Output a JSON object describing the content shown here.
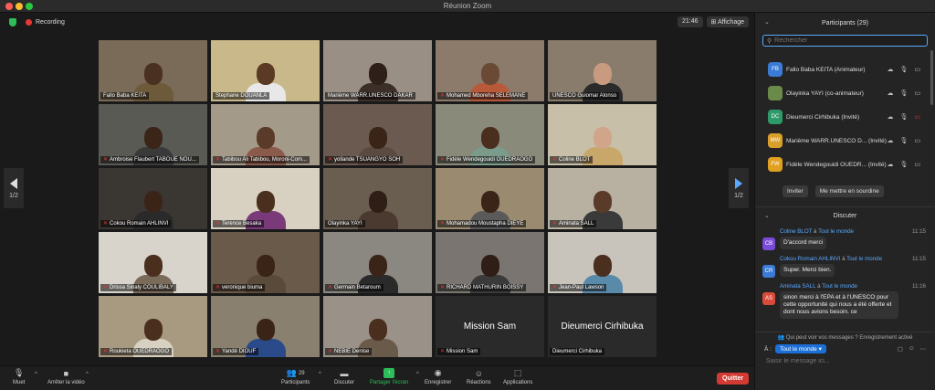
{
  "window": {
    "title": "Réunion Zoom"
  },
  "meeting": {
    "recording_label": "Recording",
    "time": "21:46",
    "view_label": "Affichage",
    "page_left": "1/2",
    "page_right": "1/2"
  },
  "tiles": [
    {
      "name": "Fallo Baba KEITA",
      "muted": false,
      "bg": "#7a6a58",
      "skin": "#4a3020",
      "shirt": "#6d5a3a"
    },
    {
      "name": "Stephane DOUANLA",
      "muted": false,
      "bg": "#c9b98a",
      "skin": "#5a3a25",
      "shirt": "#e8e8e8"
    },
    {
      "name": "Marième WARR.UNESCO DAKAR",
      "muted": false,
      "bg": "#9a8f85",
      "skin": "#2e1f18",
      "shirt": "#3c2e28"
    },
    {
      "name": "Mohamed  Mboreha SELEMANE",
      "muted": true,
      "bg": "#8c7a6a",
      "skin": "#6a4a34",
      "shirt": "#b85a3a"
    },
    {
      "name": "UNESCO Guiomar Alonso",
      "muted": false,
      "bg": "#8a7c6c",
      "skin": "#c89a80",
      "shirt": "#2a2a2a"
    },
    {
      "name": "Ambroise Flaubert TABOUE NOU...",
      "muted": true,
      "bg": "#5a5a55",
      "skin": "#3a2518",
      "shirt": "#3a3a3a"
    },
    {
      "name": "Tabibou Ali Tabibou, Moroni-Com...",
      "muted": true,
      "bg": "#a49a8a",
      "skin": "#5a3a28",
      "shirt": "#8a5a4a"
    },
    {
      "name": "yollande TSUANGYO SOH",
      "muted": true,
      "bg": "#6a5a50",
      "skin": "#3a2418",
      "shirt": "#5a4a40"
    },
    {
      "name": "Fidèle Wendegouidi OUEDRAOGO",
      "muted": true,
      "bg": "#8a8a7a",
      "skin": "#4a2e1e",
      "shirt": "#7a9a8a"
    },
    {
      "name": "Coline BLOT",
      "muted": true,
      "bg": "#c8bfa8",
      "skin": "#d0a58a",
      "shirt": "#c8a86a"
    },
    {
      "name": "Cokou Romain AHLINVI",
      "muted": true,
      "bg": "#3a3632",
      "skin": "#3a2418",
      "shirt": "#2a2a2a"
    },
    {
      "name": "Terence Besaka",
      "muted": true,
      "bg": "#d8d0c0",
      "skin": "#4a2e1e",
      "shirt": "#7a3a7a"
    },
    {
      "name": "Olayinka YAYI",
      "muted": false,
      "bg": "#6a5e50",
      "skin": "#2e1e16",
      "shirt": "#4a3a30"
    },
    {
      "name": "Mohamadou Moustapha DIEYE",
      "muted": true,
      "bg": "#9a8a70",
      "skin": "#3a2418",
      "shirt": "#5a5a5a"
    },
    {
      "name": "Aminata SALL",
      "muted": true,
      "bg": "#b8b0a0",
      "skin": "#5a3a28",
      "shirt": "#3a3a3a"
    },
    {
      "name": "Drissa Sinaly COULIBALY",
      "muted": true,
      "bg": "#d8d4cc",
      "skin": "#4a2e1e",
      "shirt": "#7a6a5a"
    },
    {
      "name": "veronique biuma",
      "muted": true,
      "bg": "#6a5a4a",
      "skin": "#3a2418",
      "shirt": "#5a4a3a"
    },
    {
      "name": "Germain Betaroum",
      "muted": true,
      "bg": "#8a8880",
      "skin": "#3a2418",
      "shirt": "#2a2a2a"
    },
    {
      "name": "RICHARD MATHURIN BOISSY",
      "muted": true,
      "bg": "#7a7570",
      "skin": "#2e1e16",
      "shirt": "#3a3a3a"
    },
    {
      "name": "Jean-Paul Lawson",
      "muted": true,
      "bg": "#c8c4bc",
      "skin": "#4a2e1e",
      "shirt": "#5a8aaa"
    },
    {
      "name": "Roukieta OUEDRAOGO",
      "muted": true,
      "bg": "#a89a80",
      "skin": "#4a2e1e",
      "shirt": "#d8d0c0"
    },
    {
      "name": "Yandé DIOUF",
      "muted": true,
      "bg": "#8a8070",
      "skin": "#3a2418",
      "shirt": "#2a4a8a"
    },
    {
      "name": "NEBIE Denise",
      "muted": true,
      "bg": "#9a9288",
      "skin": "#4a2e1e",
      "shirt": "#6a5a4a"
    },
    {
      "name": "Mission Sam",
      "muted": true,
      "bg": "#2a2a2a",
      "video_off": true,
      "big": "Mission Sam"
    },
    {
      "name": "Dieumerci Cirhibuka",
      "muted": false,
      "bg": "#2a2a2a",
      "video_off": true,
      "big": "Dieumerci Cirhibuka",
      "active": true
    }
  ],
  "toolbar": {
    "mute": "Muet",
    "video": "Arrêter la vidéo",
    "participants": "Participants",
    "participants_count": "29",
    "chat": "Discuter",
    "share": "Partager l'écran",
    "record": "Enregistrer",
    "reactions": "Réactions",
    "apps": "Applications",
    "quit": "Quitter"
  },
  "participants_panel": {
    "title": "Participants (29)",
    "search_placeholder": "Rechercher",
    "items": [
      {
        "initials": "FB",
        "color": "#3a7bd5",
        "name": "Fallo Baba KEITA (Animateur)",
        "video_off": false
      },
      {
        "initials": "",
        "color": "#6a8a4a",
        "name": "Olayinka YAYI (co-animateur)",
        "video_off": false
      },
      {
        "initials": "DC",
        "color": "#2e9a6a",
        "name": "Dieumerci Cirhibuka (Invité)",
        "video_off": true
      },
      {
        "initials": "MW",
        "color": "#d8a02a",
        "name": "Marième WARR.UNESCO D...  (Invité)",
        "video_off": false
      },
      {
        "initials": "FW",
        "color": "#e0a020",
        "name": "Fidèle Wendegouidi OUEDR...  (Invité)",
        "video_off": false
      }
    ],
    "invite_label": "Inviter",
    "mute_me_label": "Me mettre en sourdine"
  },
  "chat_panel": {
    "title": "Discuter",
    "messages": [
      {
        "initials": "CB",
        "color": "#7a4ad8",
        "from": "Coline BLOT",
        "to": "Tout le monde",
        "time": "11:15",
        "text": "D'accord merci"
      },
      {
        "initials": "CR",
        "color": "#3a7bd5",
        "from": "Cokou Romain AHLINVI",
        "to": "Tout le monde",
        "time": "11:15",
        "text": "Super. Merci bien."
      },
      {
        "initials": "AS",
        "color": "#d84a3a",
        "from": "Aminata SALL",
        "to": "Tout le monde",
        "time": "11:16",
        "text": "sinon merci à l'EPA et à l'UNESCO pour cette opportunité qui nous a été offerte et dont nous avions besoin. ce"
      }
    ],
    "to_word": "à",
    "privacy_note": "Qui peut voir vos messages ? Enregistrement activé",
    "to_label": "À :",
    "to_value": "Tout le monde",
    "input_placeholder": "Saisir le message ici..."
  },
  "colors": {
    "accent": "#5aa9ff",
    "active_speaker": "#e8e27a",
    "quit": "#d23a33"
  }
}
